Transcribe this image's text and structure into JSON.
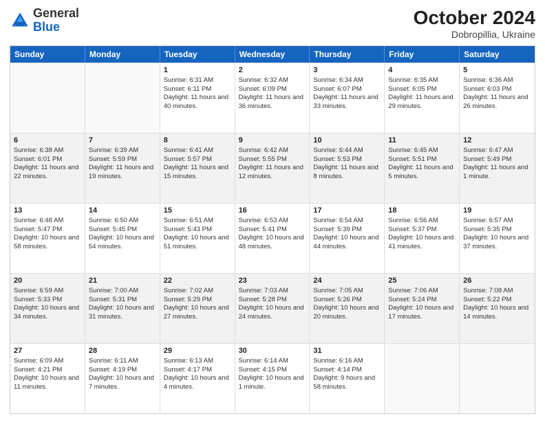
{
  "header": {
    "logo_general": "General",
    "logo_blue": "Blue",
    "month_year": "October 2024",
    "location": "Dobropillia, Ukraine"
  },
  "days_of_week": [
    "Sunday",
    "Monday",
    "Tuesday",
    "Wednesday",
    "Thursday",
    "Friday",
    "Saturday"
  ],
  "weeks": [
    [
      {
        "day": "",
        "sunrise": "",
        "sunset": "",
        "daylight": ""
      },
      {
        "day": "",
        "sunrise": "",
        "sunset": "",
        "daylight": ""
      },
      {
        "day": "1",
        "sunrise": "Sunrise: 6:31 AM",
        "sunset": "Sunset: 6:11 PM",
        "daylight": "Daylight: 11 hours and 40 minutes."
      },
      {
        "day": "2",
        "sunrise": "Sunrise: 6:32 AM",
        "sunset": "Sunset: 6:09 PM",
        "daylight": "Daylight: 11 hours and 36 minutes."
      },
      {
        "day": "3",
        "sunrise": "Sunrise: 6:34 AM",
        "sunset": "Sunset: 6:07 PM",
        "daylight": "Daylight: 11 hours and 33 minutes."
      },
      {
        "day": "4",
        "sunrise": "Sunrise: 6:35 AM",
        "sunset": "Sunset: 6:05 PM",
        "daylight": "Daylight: 11 hours and 29 minutes."
      },
      {
        "day": "5",
        "sunrise": "Sunrise: 6:36 AM",
        "sunset": "Sunset: 6:03 PM",
        "daylight": "Daylight: 11 hours and 26 minutes."
      }
    ],
    [
      {
        "day": "6",
        "sunrise": "Sunrise: 6:38 AM",
        "sunset": "Sunset: 6:01 PM",
        "daylight": "Daylight: 11 hours and 22 minutes."
      },
      {
        "day": "7",
        "sunrise": "Sunrise: 6:39 AM",
        "sunset": "Sunset: 5:59 PM",
        "daylight": "Daylight: 11 hours and 19 minutes."
      },
      {
        "day": "8",
        "sunrise": "Sunrise: 6:41 AM",
        "sunset": "Sunset: 5:57 PM",
        "daylight": "Daylight: 11 hours and 15 minutes."
      },
      {
        "day": "9",
        "sunrise": "Sunrise: 6:42 AM",
        "sunset": "Sunset: 5:55 PM",
        "daylight": "Daylight: 11 hours and 12 minutes."
      },
      {
        "day": "10",
        "sunrise": "Sunrise: 6:44 AM",
        "sunset": "Sunset: 5:53 PM",
        "daylight": "Daylight: 11 hours and 8 minutes."
      },
      {
        "day": "11",
        "sunrise": "Sunrise: 6:45 AM",
        "sunset": "Sunset: 5:51 PM",
        "daylight": "Daylight: 11 hours and 5 minutes."
      },
      {
        "day": "12",
        "sunrise": "Sunrise: 6:47 AM",
        "sunset": "Sunset: 5:49 PM",
        "daylight": "Daylight: 11 hours and 1 minute."
      }
    ],
    [
      {
        "day": "13",
        "sunrise": "Sunrise: 6:48 AM",
        "sunset": "Sunset: 5:47 PM",
        "daylight": "Daylight: 10 hours and 58 minutes."
      },
      {
        "day": "14",
        "sunrise": "Sunrise: 6:50 AM",
        "sunset": "Sunset: 5:45 PM",
        "daylight": "Daylight: 10 hours and 54 minutes."
      },
      {
        "day": "15",
        "sunrise": "Sunrise: 6:51 AM",
        "sunset": "Sunset: 5:43 PM",
        "daylight": "Daylight: 10 hours and 51 minutes."
      },
      {
        "day": "16",
        "sunrise": "Sunrise: 6:53 AM",
        "sunset": "Sunset: 5:41 PM",
        "daylight": "Daylight: 10 hours and 48 minutes."
      },
      {
        "day": "17",
        "sunrise": "Sunrise: 6:54 AM",
        "sunset": "Sunset: 5:39 PM",
        "daylight": "Daylight: 10 hours and 44 minutes."
      },
      {
        "day": "18",
        "sunrise": "Sunrise: 6:56 AM",
        "sunset": "Sunset: 5:37 PM",
        "daylight": "Daylight: 10 hours and 41 minutes."
      },
      {
        "day": "19",
        "sunrise": "Sunrise: 6:57 AM",
        "sunset": "Sunset: 5:35 PM",
        "daylight": "Daylight: 10 hours and 37 minutes."
      }
    ],
    [
      {
        "day": "20",
        "sunrise": "Sunrise: 6:59 AM",
        "sunset": "Sunset: 5:33 PM",
        "daylight": "Daylight: 10 hours and 34 minutes."
      },
      {
        "day": "21",
        "sunrise": "Sunrise: 7:00 AM",
        "sunset": "Sunset: 5:31 PM",
        "daylight": "Daylight: 10 hours and 31 minutes."
      },
      {
        "day": "22",
        "sunrise": "Sunrise: 7:02 AM",
        "sunset": "Sunset: 5:29 PM",
        "daylight": "Daylight: 10 hours and 27 minutes."
      },
      {
        "day": "23",
        "sunrise": "Sunrise: 7:03 AM",
        "sunset": "Sunset: 5:28 PM",
        "daylight": "Daylight: 10 hours and 24 minutes."
      },
      {
        "day": "24",
        "sunrise": "Sunrise: 7:05 AM",
        "sunset": "Sunset: 5:26 PM",
        "daylight": "Daylight: 10 hours and 20 minutes."
      },
      {
        "day": "25",
        "sunrise": "Sunrise: 7:06 AM",
        "sunset": "Sunset: 5:24 PM",
        "daylight": "Daylight: 10 hours and 17 minutes."
      },
      {
        "day": "26",
        "sunrise": "Sunrise: 7:08 AM",
        "sunset": "Sunset: 5:22 PM",
        "daylight": "Daylight: 10 hours and 14 minutes."
      }
    ],
    [
      {
        "day": "27",
        "sunrise": "Sunrise: 6:09 AM",
        "sunset": "Sunset: 4:21 PM",
        "daylight": "Daylight: 10 hours and 11 minutes."
      },
      {
        "day": "28",
        "sunrise": "Sunrise: 6:11 AM",
        "sunset": "Sunset: 4:19 PM",
        "daylight": "Daylight: 10 hours and 7 minutes."
      },
      {
        "day": "29",
        "sunrise": "Sunrise: 6:13 AM",
        "sunset": "Sunset: 4:17 PM",
        "daylight": "Daylight: 10 hours and 4 minutes."
      },
      {
        "day": "30",
        "sunrise": "Sunrise: 6:14 AM",
        "sunset": "Sunset: 4:15 PM",
        "daylight": "Daylight: 10 hours and 1 minute."
      },
      {
        "day": "31",
        "sunrise": "Sunrise: 6:16 AM",
        "sunset": "Sunset: 4:14 PM",
        "daylight": "Daylight: 9 hours and 58 minutes."
      },
      {
        "day": "",
        "sunrise": "",
        "sunset": "",
        "daylight": ""
      },
      {
        "day": "",
        "sunrise": "",
        "sunset": "",
        "daylight": ""
      }
    ]
  ]
}
